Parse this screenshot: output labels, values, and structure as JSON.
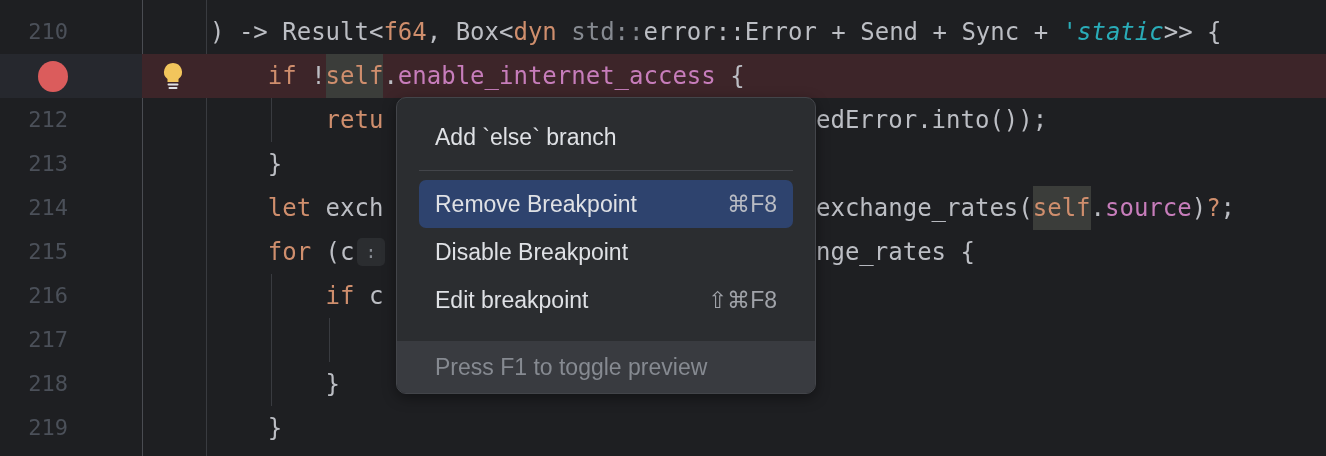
{
  "editor": {
    "lines": [
      {
        "number": "210",
        "tokens": [
          {
            "text": ") -> Result<",
            "kind": "plain"
          },
          {
            "text": "f64",
            "kind": "keyword"
          },
          {
            "text": ", Box<",
            "kind": "plain"
          },
          {
            "text": "dyn",
            "kind": "keyword"
          },
          {
            "text": " std::",
            "kind": "muted"
          },
          {
            "text": "error::Error + Send + Sync + ",
            "kind": "plain"
          },
          {
            "text": "'static",
            "kind": "lifetime"
          },
          {
            "text": ">> {",
            "kind": "plain"
          }
        ],
        "children": [
          {
            "breakpoint": true,
            "bulb": true,
            "tokens": [
              {
                "text": "if",
                "kind": "keyword"
              },
              {
                "text": " !",
                "kind": "plain"
              },
              {
                "text": "self",
                "kind": "self"
              },
              {
                "text": ".",
                "kind": "plain"
              },
              {
                "text": "enable_internet_access",
                "kind": "field"
              },
              {
                "text": " {",
                "kind": "plain"
              }
            ],
            "children": [
              {
                "number": "212",
                "tokens": [
                  {
                    "text": "retu",
                    "kind": "keyword"
                  }
                ],
                "after": [
                  {
                    "text": "edError.into());",
                    "kind": "plain"
                  }
                ]
              }
            ]
          },
          {
            "number": "213",
            "tokens": [
              {
                "text": "}",
                "kind": "plain"
              }
            ]
          },
          {
            "number": "214",
            "tokens": [
              {
                "text": "let",
                "kind": "keyword"
              },
              {
                "text": " exch",
                "kind": "plain"
              }
            ],
            "after": [
              {
                "text": "exchange_rates(",
                "kind": "plain"
              },
              {
                "text": "self",
                "kind": "self"
              },
              {
                "text": ".",
                "kind": "plain"
              },
              {
                "text": "source",
                "kind": "field"
              },
              {
                "text": ")",
                "kind": "plain"
              },
              {
                "text": "?",
                "kind": "keyword"
              },
              {
                "text": ";",
                "kind": "plain"
              }
            ]
          },
          {
            "number": "215",
            "tokens": [
              {
                "text": "for",
                "kind": "keyword"
              },
              {
                "text": " (c",
                "kind": "plain"
              },
              {
                "text": ":",
                "kind": "hint"
              }
            ],
            "after": [
              {
                "text": "nge_rates {",
                "kind": "plain"
              }
            ],
            "children": [
              {
                "number": "216",
                "tokens": [
                  {
                    "text": "if",
                    "kind": "keyword"
                  },
                  {
                    "text": " c",
                    "kind": "plain"
                  }
                ],
                "children": [
                  {
                    "number": "217"
                  }
                ]
              },
              {
                "number": "218",
                "tokens": [
                  {
                    "text": "}",
                    "kind": "plain"
                  }
                ]
              }
            ]
          },
          {
            "number": "219",
            "tokens": [
              {
                "text": "}",
                "kind": "plain"
              }
            ]
          }
        ]
      }
    ]
  },
  "context_menu": {
    "items": [
      {
        "kind": "action",
        "label": "Add `else` branch",
        "selected": false
      },
      {
        "kind": "separator"
      },
      {
        "kind": "action",
        "label": "Remove Breakpoint",
        "shortcut": "⌘F8",
        "selected": true
      },
      {
        "kind": "action",
        "label": "Disable Breakpoint",
        "selected": false
      },
      {
        "kind": "action",
        "label": "Edit breakpoint",
        "shortcut": "⇧⌘F8",
        "selected": false
      }
    ],
    "footer": "Press F1 to toggle preview"
  }
}
